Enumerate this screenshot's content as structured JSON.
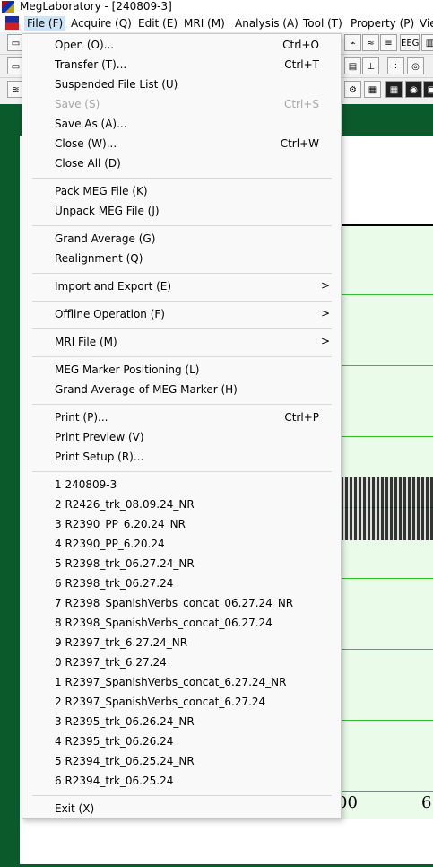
{
  "window": {
    "title": "MegLaboratory  - [240809-3]"
  },
  "menubar": [
    "File (F)",
    "Acquire (Q)",
    "Edit (E)",
    "MRI (M)",
    "Analysis (A)",
    "Tool (T)",
    "Property (P)",
    "Vie"
  ],
  "toolbar": {
    "eeg_label": "EEG"
  },
  "file_menu": {
    "items": [
      {
        "label": "Open (O)...",
        "shortcut": "Ctrl+O"
      },
      {
        "label": "Transfer (T)...",
        "shortcut": "Ctrl+T"
      },
      {
        "label": "Suspended File List (U)",
        "shortcut": ""
      },
      {
        "label": "Save (S)",
        "shortcut": "Ctrl+S"
      },
      {
        "label": "Save As (A)...",
        "shortcut": ""
      },
      {
        "label": "Close (W)...",
        "shortcut": "Ctrl+W"
      },
      {
        "label": "Close All (D)",
        "shortcut": ""
      },
      {
        "label": "Pack MEG File (K)",
        "shortcut": ""
      },
      {
        "label": "Unpack MEG File (J)",
        "shortcut": ""
      },
      {
        "label": "Grand Average (G)",
        "shortcut": ""
      },
      {
        "label": "Realignment (Q)",
        "shortcut": ""
      },
      {
        "label": "Import and Export (E)",
        "shortcut": ""
      },
      {
        "label": "Offline Operation (F)",
        "shortcut": ""
      },
      {
        "label": "MRI File (M)",
        "shortcut": ""
      },
      {
        "label": "MEG Marker Positioning (L)",
        "shortcut": ""
      },
      {
        "label": "Grand Average of MEG Marker (H)",
        "shortcut": ""
      },
      {
        "label": "Print (P)...",
        "shortcut": "Ctrl+P"
      },
      {
        "label": "Print Preview (V)",
        "shortcut": ""
      },
      {
        "label": "Print Setup (R)...",
        "shortcut": ""
      },
      {
        "label": "1 240809-3",
        "shortcut": ""
      },
      {
        "label": "2 R2426_trk_08.09.24_NR",
        "shortcut": ""
      },
      {
        "label": "3 R2390_PP_6.20.24_NR",
        "shortcut": ""
      },
      {
        "label": "4 R2390_PP_6.20.24",
        "shortcut": ""
      },
      {
        "label": "5 R2398_trk_06.27.24_NR",
        "shortcut": ""
      },
      {
        "label": "6 R2398_trk_06.27.24",
        "shortcut": ""
      },
      {
        "label": "7 R2398_SpanishVerbs_concat_06.27.24_NR",
        "shortcut": ""
      },
      {
        "label": "8 R2398_SpanishVerbs_concat_06.27.24",
        "shortcut": ""
      },
      {
        "label": "9 R2397_trk_6.27.24_NR",
        "shortcut": ""
      },
      {
        "label": "0 R2397_trk_6.27.24",
        "shortcut": ""
      },
      {
        "label": "1 R2397_SpanishVerbs_concat_6.27.24_NR",
        "shortcut": ""
      },
      {
        "label": "2 R2397_SpanishVerbs_concat_6.27.24",
        "shortcut": ""
      },
      {
        "label": "3 R2395_trk_06.26.24_NR",
        "shortcut": ""
      },
      {
        "label": "4 R2395_trk_06.26.24",
        "shortcut": ""
      },
      {
        "label": "5 R2394_trk_06.25.24_NR",
        "shortcut": ""
      },
      {
        "label": "6 R2394_trk_06.25.24",
        "shortcut": ""
      },
      {
        "label": "Exit (X)",
        "shortcut": ""
      }
    ]
  },
  "plot": {
    "tick_partial_1": "00",
    "tick_partial_2": "6"
  }
}
